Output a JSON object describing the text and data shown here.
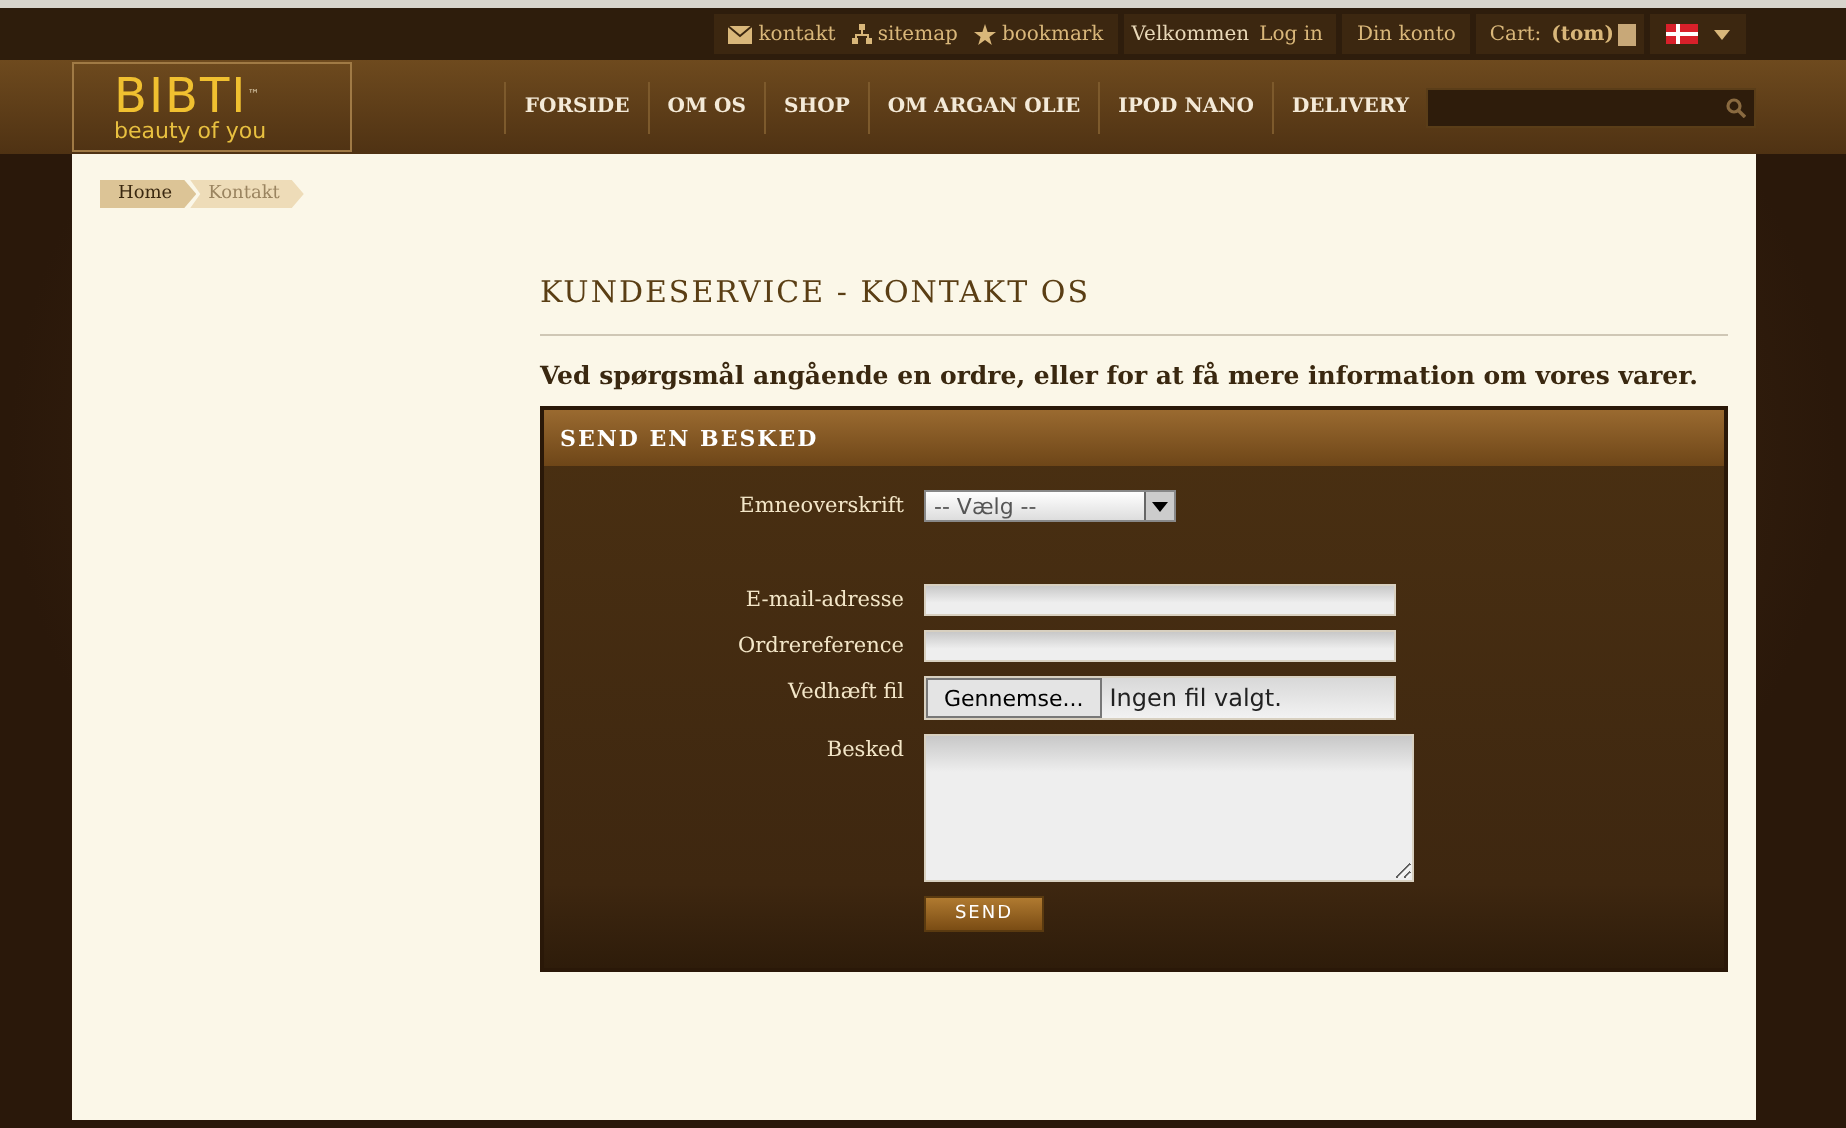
{
  "top_bar": {
    "links": [
      {
        "kind": "mail",
        "label": "kontakt"
      },
      {
        "kind": "sitemap",
        "label": "sitemap"
      },
      {
        "kind": "star",
        "label": "bookmark"
      }
    ],
    "welcome": {
      "text": "Velkommen",
      "link": "Log in"
    },
    "account": "Din konto",
    "cart": {
      "label": "Cart:",
      "value": "(tom)"
    }
  },
  "logo": {
    "name": "BIBTI",
    "tm": "™",
    "tagline": "beauty of you"
  },
  "nav": [
    "FORSIDE",
    "OM OS",
    "SHOP",
    "OM ARGAN OLIE",
    "IPOD NANO",
    "DELIVERY"
  ],
  "breadcrumb": [
    {
      "label": "Home",
      "current": false
    },
    {
      "label": "Kontakt",
      "current": true
    }
  ],
  "page_title": "KUNDESERVICE - KONTAKT OS",
  "intro": "Ved spørgsmål angående en ordre, eller for at få mere information om vores varer.",
  "form": {
    "title": "SEND EN BESKED",
    "fields": [
      {
        "kind": "select",
        "label": "Emneoverskrift",
        "value": "-- Vælg --"
      },
      {
        "kind": "spacer"
      },
      {
        "kind": "text",
        "label": "E-mail-adresse"
      },
      {
        "kind": "text",
        "label": "Ordrereference"
      },
      {
        "kind": "file",
        "label": "Vedhæft fil",
        "button": "Gennemse...",
        "value": "Ingen fil valgt."
      },
      {
        "kind": "textarea",
        "label": "Besked"
      }
    ],
    "submit": "SEND"
  }
}
